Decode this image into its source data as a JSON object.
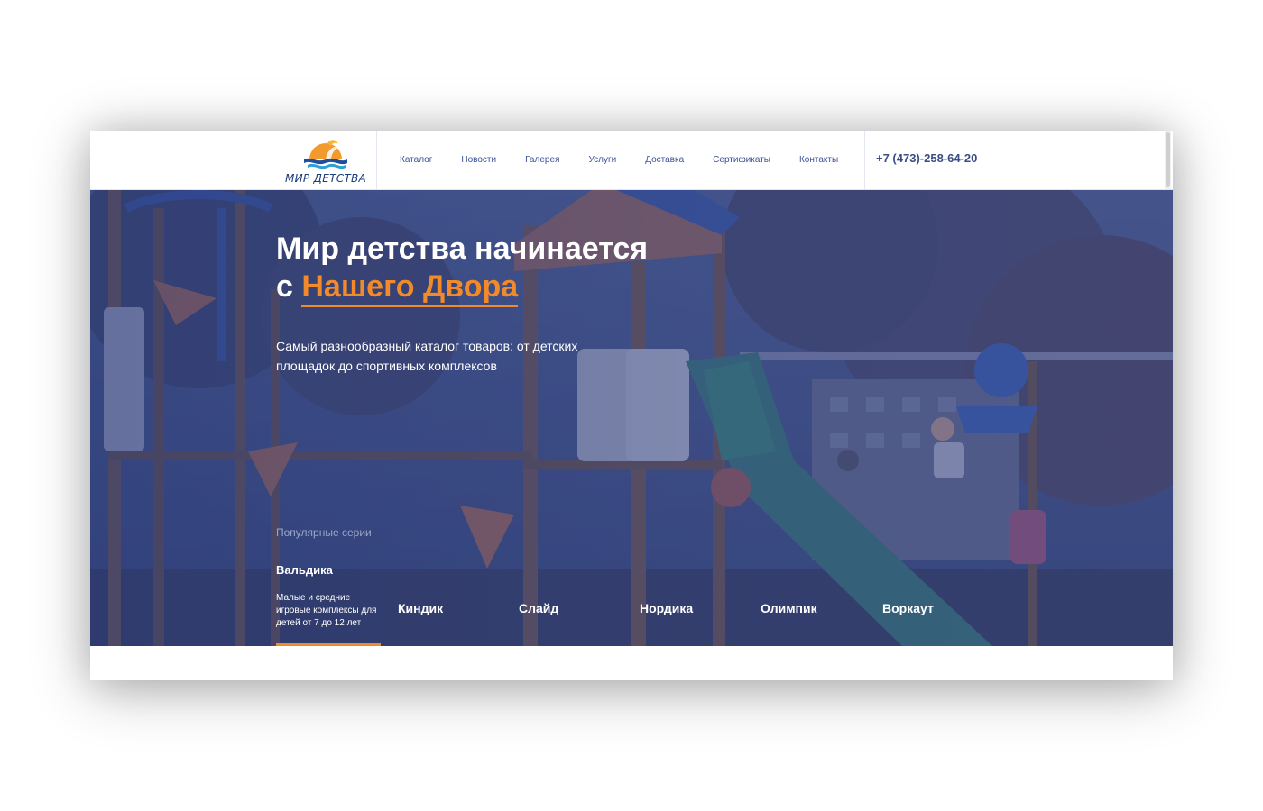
{
  "brand": {
    "name": "МИР ДЕТСТВА",
    "logo_icon": "sun-waves-logo-icon",
    "colors": {
      "orange": "#f08a2a",
      "navy": "#1d3d7c",
      "nav_text": "#3a5299"
    }
  },
  "nav": {
    "items": [
      {
        "label": "Каталог"
      },
      {
        "label": "Новости"
      },
      {
        "label": "Галерея"
      },
      {
        "label": "Услуги"
      },
      {
        "label": "Доставка"
      },
      {
        "label": "Сертификаты"
      },
      {
        "label": "Контакты"
      }
    ]
  },
  "header": {
    "phone": "+7 (473)-258-64-20"
  },
  "hero": {
    "title_line1": "Мир детства начинается",
    "title_prefix": "с",
    "title_accent": "Нашего Двора",
    "subtitle": "Самый разнообразный каталог товаров: от детских площадок до спортивных комплексов"
  },
  "series": {
    "label": "Популярные серии",
    "active": {
      "name": "Вальдика",
      "description": "Малые и средние игровые комплексы для детей от 7 до 12 лет"
    },
    "items": [
      {
        "name": "Киндик"
      },
      {
        "name": "Слайд"
      },
      {
        "name": "Нордика"
      },
      {
        "name": "Олимпик"
      },
      {
        "name": "Воркаут"
      }
    ]
  }
}
